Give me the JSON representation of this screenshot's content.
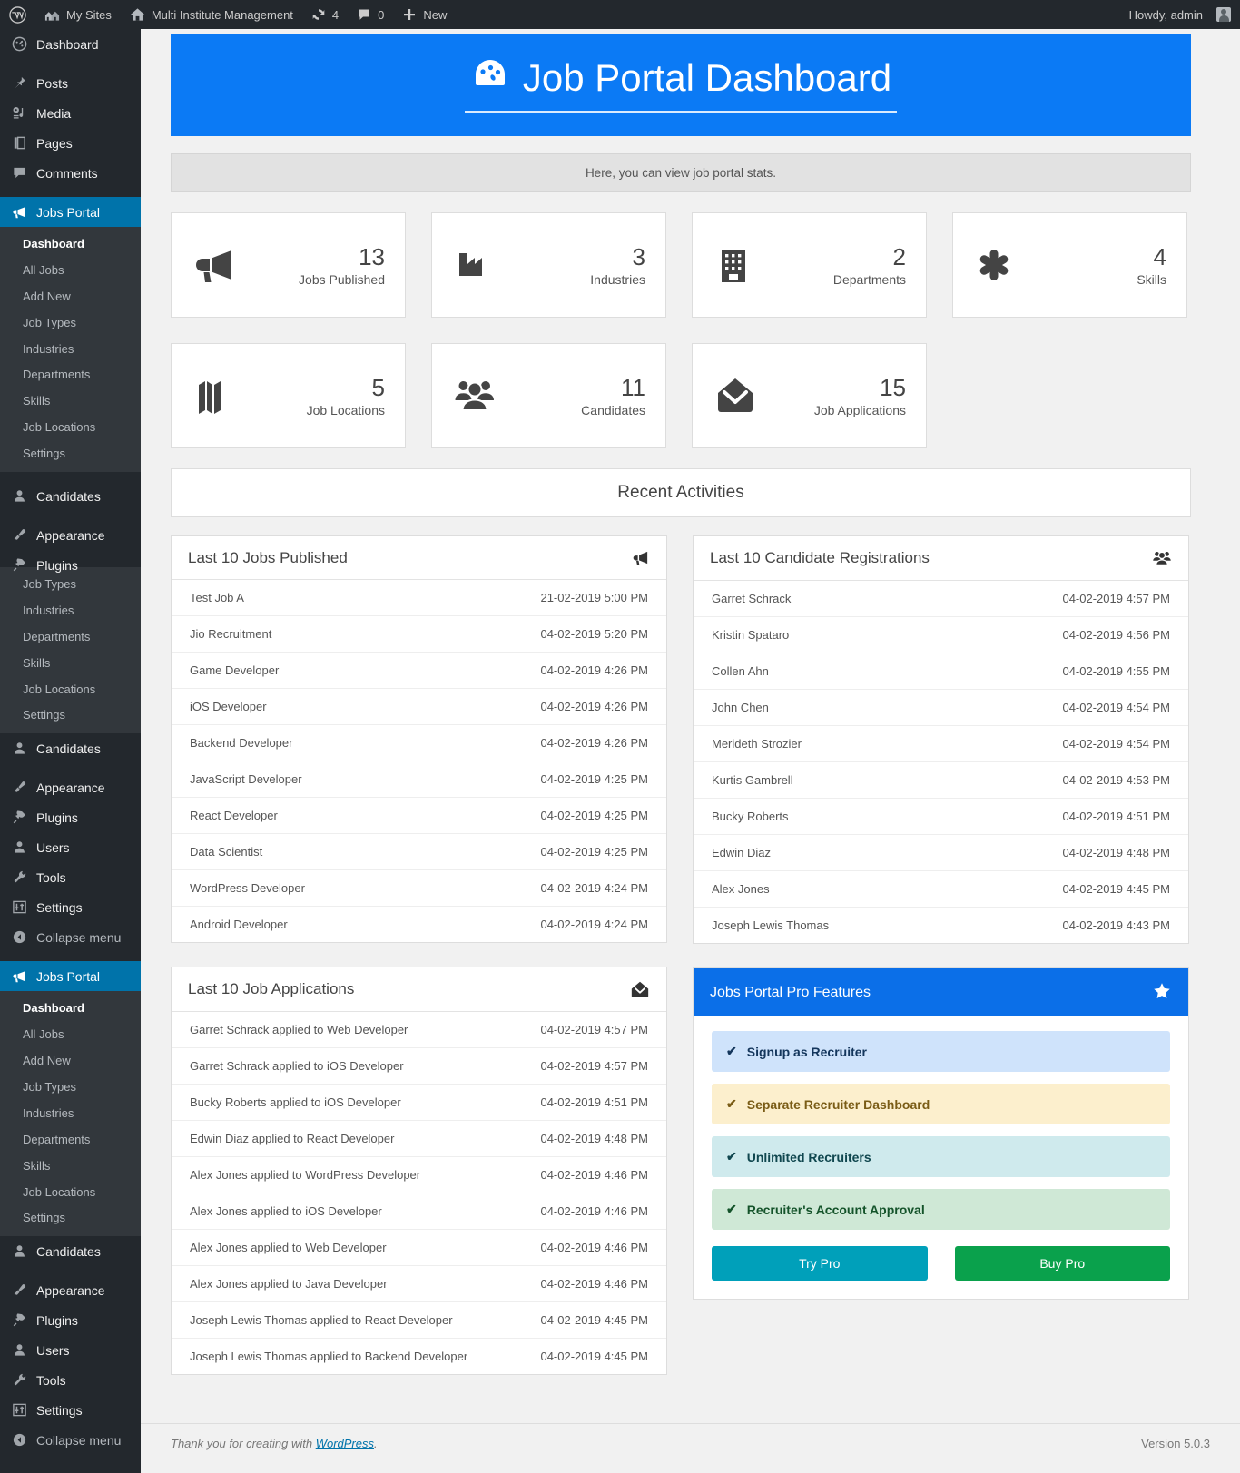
{
  "adminbar": {
    "wp_logo": "wordpress-logo-icon",
    "my_sites": "My Sites",
    "site_name": "Multi Institute Management",
    "updates_count": "4",
    "comments_count": "0",
    "new_label": "New",
    "howdy": "Howdy, admin"
  },
  "sidebar": {
    "primary": [
      {
        "label": "Dashboard",
        "icon": "dashboard-icon"
      },
      {
        "label": "Posts",
        "icon": "pin-icon"
      },
      {
        "label": "Media",
        "icon": "media-icon"
      },
      {
        "label": "Pages",
        "icon": "pages-icon"
      },
      {
        "label": "Comments",
        "icon": "comment-icon"
      }
    ],
    "jobs_portal_label": "Jobs Portal",
    "jobs_portal_icon": "megaphone-icon",
    "jobs_submenu": [
      "Dashboard",
      "All Jobs",
      "Add New",
      "Job Types",
      "Industries",
      "Departments",
      "Skills",
      "Job Locations",
      "Settings"
    ],
    "after": [
      {
        "label": "Candidates",
        "icon": "user-icon"
      },
      {
        "label": "Appearance",
        "icon": "brush-icon"
      },
      {
        "label": "Plugins",
        "icon": "plug-icon"
      },
      {
        "label": "Users",
        "icon": "user-icon"
      },
      {
        "label": "Tools",
        "icon": "wrench-icon"
      },
      {
        "label": "Settings",
        "icon": "sliders-icon"
      },
      {
        "label": "Collapse menu",
        "icon": "collapse-icon"
      }
    ],
    "overlap_partial": [
      {
        "label": "Candidates",
        "icon": "user-icon"
      },
      {
        "label": "Appearance",
        "icon": "brush-icon"
      },
      {
        "label": "Plugins",
        "icon": "plug-icon"
      }
    ]
  },
  "header": {
    "title": "Job Portal Dashboard",
    "icon": "dashboard-gauge-icon",
    "bg_color": "#0b7af5",
    "subtitle": "Here, you can view job portal stats."
  },
  "stats": [
    {
      "value": "13",
      "label": "Jobs Published",
      "icon": "megaphone-icon"
    },
    {
      "value": "3",
      "label": "Industries",
      "icon": "factory-icon"
    },
    {
      "value": "2",
      "label": "Departments",
      "icon": "building-icon"
    },
    {
      "value": "4",
      "label": "Skills",
      "icon": "asterisk-icon"
    },
    {
      "value": "5",
      "label": "Job Locations",
      "icon": "map-icon"
    },
    {
      "value": "11",
      "label": "Candidates",
      "icon": "users-icon"
    },
    {
      "value": "15",
      "label": "Job Applications",
      "icon": "envelope-icon"
    }
  ],
  "recent_activities_title": "Recent Activities",
  "jobs_panel": {
    "title": "Last 10 Jobs Published",
    "icon": "megaphone-icon",
    "rows": [
      {
        "name": "Test Job A",
        "time": "21-02-2019 5:00 PM"
      },
      {
        "name": "Jio Recruitment",
        "time": "04-02-2019 5:20 PM"
      },
      {
        "name": "Game Developer",
        "time": "04-02-2019 4:26 PM"
      },
      {
        "name": "iOS Developer",
        "time": "04-02-2019 4:26 PM"
      },
      {
        "name": "Backend Developer",
        "time": "04-02-2019 4:26 PM"
      },
      {
        "name": "JavaScript Developer",
        "time": "04-02-2019 4:25 PM"
      },
      {
        "name": "React Developer",
        "time": "04-02-2019 4:25 PM"
      },
      {
        "name": "Data Scientist",
        "time": "04-02-2019 4:25 PM"
      },
      {
        "name": "WordPress Developer",
        "time": "04-02-2019 4:24 PM"
      },
      {
        "name": "Android Developer",
        "time": "04-02-2019 4:24 PM"
      }
    ]
  },
  "candidates_panel": {
    "title": "Last 10 Candidate Registrations",
    "icon": "users-icon",
    "rows": [
      {
        "name": "Garret Schrack",
        "time": "04-02-2019 4:57 PM"
      },
      {
        "name": "Kristin Spataro",
        "time": "04-02-2019 4:56 PM"
      },
      {
        "name": "Collen Ahn",
        "time": "04-02-2019 4:55 PM"
      },
      {
        "name": "John Chen",
        "time": "04-02-2019 4:54 PM"
      },
      {
        "name": "Merideth Strozier",
        "time": "04-02-2019 4:54 PM"
      },
      {
        "name": "Kurtis Gambrell",
        "time": "04-02-2019 4:53 PM"
      },
      {
        "name": "Bucky Roberts",
        "time": "04-02-2019 4:51 PM"
      },
      {
        "name": "Edwin Diaz",
        "time": "04-02-2019 4:48 PM"
      },
      {
        "name": "Alex Jones",
        "time": "04-02-2019 4:45 PM"
      },
      {
        "name": "Joseph Lewis Thomas",
        "time": "04-02-2019 4:43 PM"
      }
    ]
  },
  "applications_panel": {
    "title": "Last 10 Job Applications",
    "icon": "envelope-icon",
    "rows": [
      {
        "name": "Garret Schrack applied to Web Developer",
        "time": "04-02-2019 4:57 PM"
      },
      {
        "name": "Garret Schrack applied to iOS Developer",
        "time": "04-02-2019 4:57 PM"
      },
      {
        "name": "Bucky Roberts applied to iOS Developer",
        "time": "04-02-2019 4:51 PM"
      },
      {
        "name": "Edwin Diaz applied to React Developer",
        "time": "04-02-2019 4:48 PM"
      },
      {
        "name": "Alex Jones applied to WordPress Developer",
        "time": "04-02-2019 4:46 PM"
      },
      {
        "name": "Alex Jones applied to iOS Developer",
        "time": "04-02-2019 4:46 PM"
      },
      {
        "name": "Alex Jones applied to Web Developer",
        "time": "04-02-2019 4:46 PM"
      },
      {
        "name": "Alex Jones applied to Java Developer",
        "time": "04-02-2019 4:46 PM"
      },
      {
        "name": "Joseph Lewis Thomas applied to React Developer",
        "time": "04-02-2019 4:45 PM"
      },
      {
        "name": "Joseph Lewis Thomas applied to Backend Developer",
        "time": "04-02-2019 4:45 PM"
      }
    ]
  },
  "pro_panel": {
    "title": "Jobs Portal Pro Features",
    "icon": "star-icon",
    "header_color": "#0b6fe8",
    "features": [
      {
        "label": "Signup as Recruiter",
        "tone": "blue",
        "check": "check-icon"
      },
      {
        "label": "Separate Recruiter Dashboard",
        "tone": "yellow",
        "check": "check-icon"
      },
      {
        "label": "Unlimited Recruiters",
        "tone": "teal",
        "check": "check-icon"
      },
      {
        "label": "Recruiter's Account Approval",
        "tone": "green",
        "check": "check-icon"
      }
    ],
    "try_label": "Try Pro",
    "buy_label": "Buy Pro",
    "try_color": "#00a0ba",
    "buy_color": "#0aa14c"
  },
  "footer": {
    "thanks_prefix": "Thank you for creating with ",
    "wordpress_link": "WordPress",
    "thanks_suffix": ".",
    "version": "Version 5.0.3"
  }
}
